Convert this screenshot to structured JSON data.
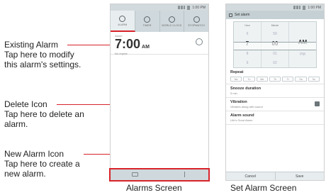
{
  "callouts": {
    "existing": {
      "title": "Existing Alarm",
      "desc1": "Tap here to modify",
      "desc2": "this alarm's settings."
    },
    "delete": {
      "title": "Delete Icon",
      "desc1": "Tap here to delete an",
      "desc2": "alarm."
    },
    "new": {
      "title": "New Alarm Icon",
      "desc1": "Tap here to create a",
      "desc2": "new alarm."
    }
  },
  "alarms_screen": {
    "status_time": "1:00 PM",
    "tabs": [
      {
        "label": "ALARM",
        "icon": "alarm-clock-icon",
        "active": true
      },
      {
        "label": "TIMER",
        "icon": "timer-icon",
        "active": false
      },
      {
        "label": "WORLD CLOCK",
        "icon": "world-clock-icon",
        "active": false
      },
      {
        "label": "STOPWATCH",
        "icon": "stopwatch-icon",
        "active": false
      }
    ],
    "alarm": {
      "caption": "Alarm",
      "time": "7:00",
      "ampm": "AM",
      "sub": "No repeat"
    },
    "bottom_icons": [
      "delete-icon",
      "new-alarm-icon"
    ]
  },
  "set_alarm_screen": {
    "status_time": "1:00 PM",
    "title": "Set alarm",
    "picker": {
      "headers": [
        "Hour",
        "Minute",
        ""
      ],
      "hours": [
        "5",
        "6",
        "7",
        "8",
        "9"
      ],
      "minutes": [
        "58",
        "59",
        "00",
        "01",
        "02"
      ],
      "ampm": [
        "",
        "",
        "AM",
        "PM",
        ""
      ]
    },
    "repeat_title": "Repeat",
    "days": [
      "Mo",
      "Tu",
      "We",
      "Th",
      "Fr",
      "Sa",
      "Su"
    ],
    "snooze_title": "Snooze duration",
    "snooze_value": "5 min",
    "vibration_title": "Vibration",
    "vibration_sub": "Vibrates along with sound",
    "sound_title": "Alarm sound",
    "sound_value": "Life's Good Alarm",
    "cancel_label": "Cancel",
    "save_label": "Save"
  },
  "captions": {
    "left": "Alarms Screen",
    "right": "Set Alarm Screen"
  },
  "colors": {
    "accent": "#d8232a",
    "bar": "#cfd8dc"
  }
}
